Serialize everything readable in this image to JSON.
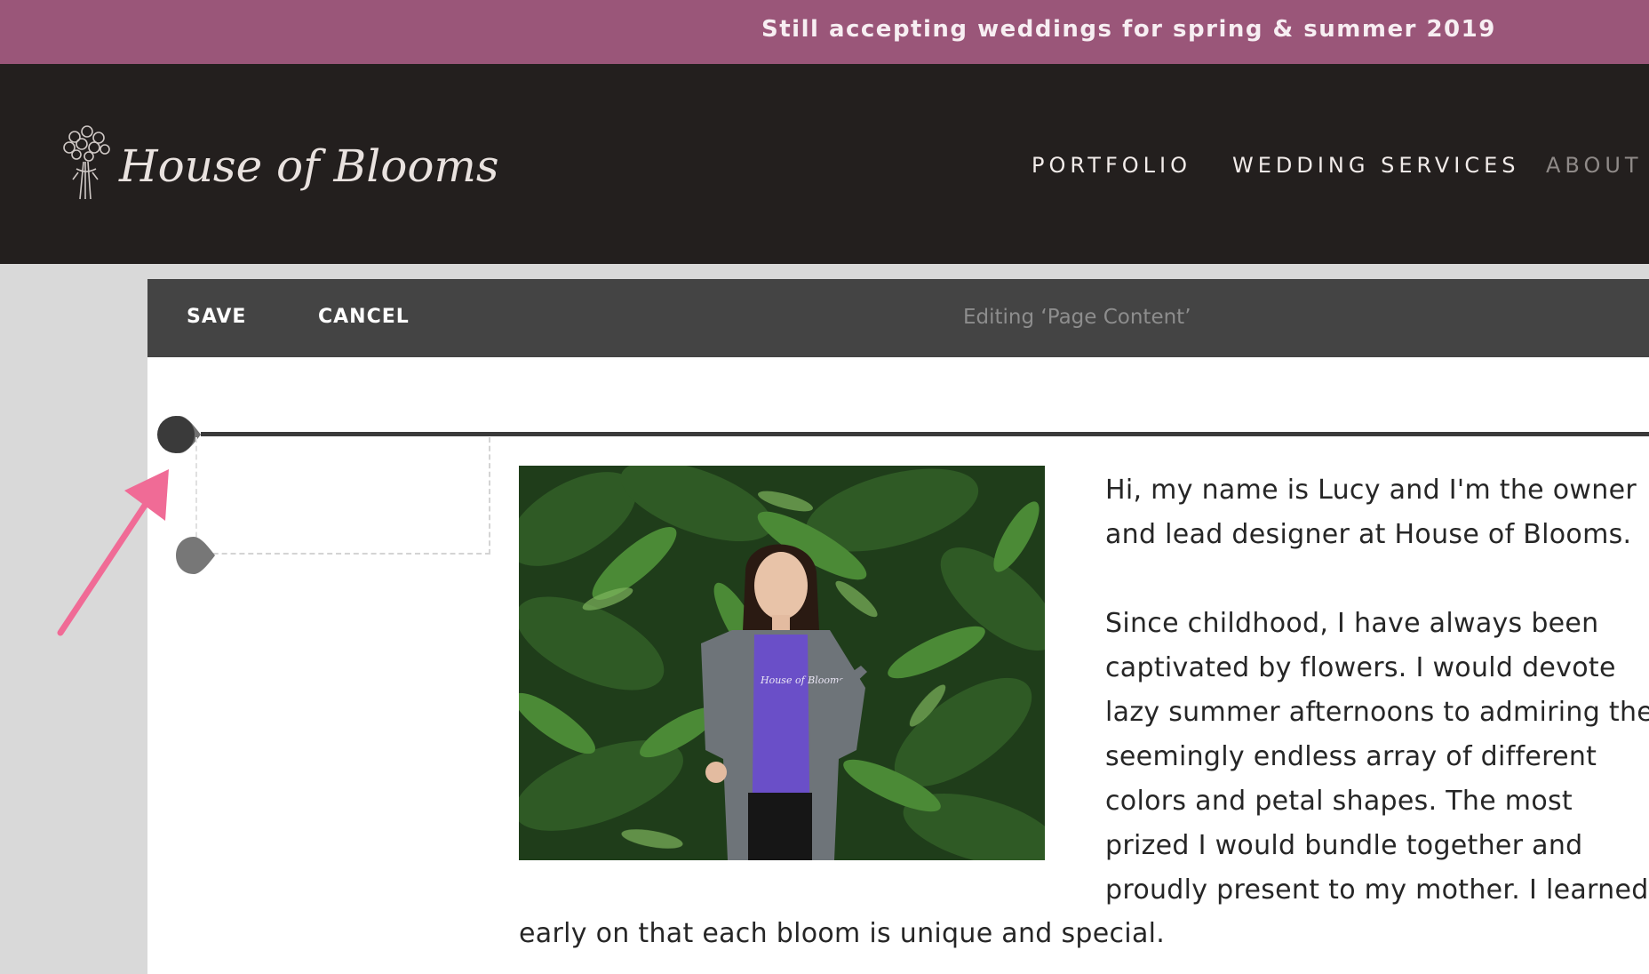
{
  "announcement": {
    "text": "Still accepting weddings for spring & summer 2019"
  },
  "header": {
    "logo_text": "House of Blooms",
    "nav": [
      {
        "label": "PORTFOLIO"
      },
      {
        "label": "WEDDING SERVICES"
      },
      {
        "label": "ABOUT"
      }
    ]
  },
  "toolbar": {
    "save_label": "SAVE",
    "cancel_label": "CANCEL",
    "status": "Editing ‘Page Content’"
  },
  "content": {
    "paragraph1": [
      "Hi, my name is Lucy and I'm the owner",
      "and lead designer at House of Blooms."
    ],
    "paragraph2": [
      "Since childhood, I have always been",
      "captivated by flowers. I would devote",
      "lazy summer afternoons to admiring the",
      "seemingly endless array of different",
      "colors and petal shapes. The most",
      "prized I would bundle together and",
      "proudly present to my mother. I learned"
    ],
    "paragraph2_tail": "early on that each bloom is unique and special.",
    "photo_shirt_text": "House of Blooms"
  },
  "colors": {
    "announcement_bg": "#9a5679",
    "header_bg": "#231f1e",
    "toolbar_bg": "#444444",
    "annotation_arrow": "#f06b96"
  },
  "icons": {
    "logo": "bouquet-icon",
    "row_handle": "drag-handle-icon",
    "annotation": "pointer-arrow-icon"
  }
}
